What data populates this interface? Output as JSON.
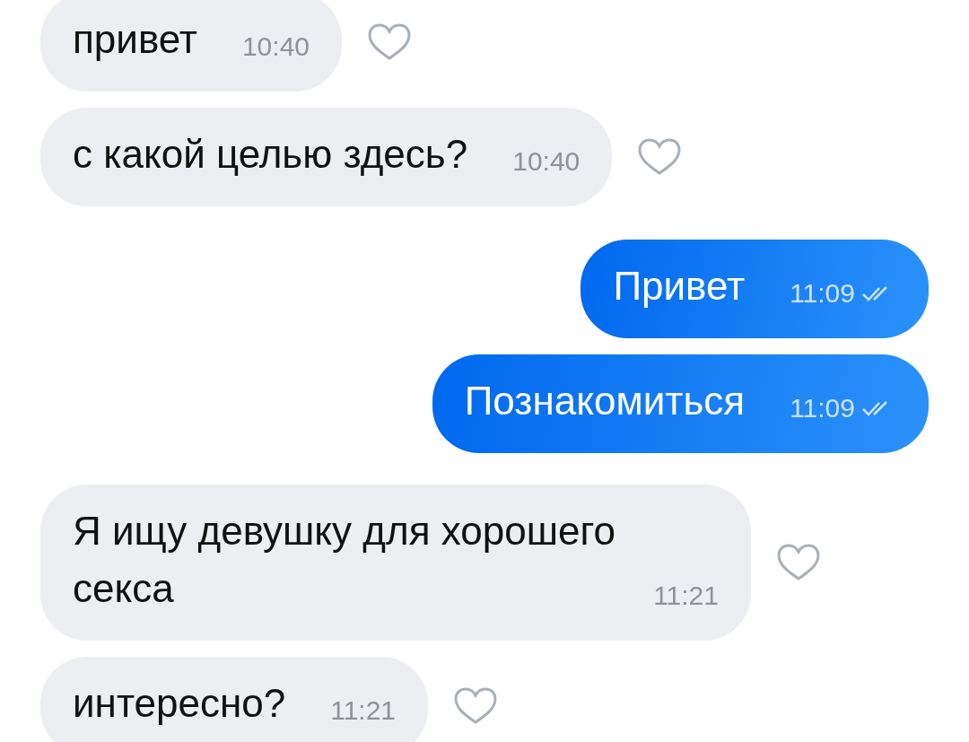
{
  "messages": [
    {
      "kind": "incoming",
      "text": "привет",
      "time": "10:40",
      "liked": false
    },
    {
      "kind": "incoming",
      "text": "с какой целью здесь?",
      "time": "10:40",
      "liked": false
    },
    {
      "kind": "outgoing",
      "text": "Привет",
      "time": "11:09",
      "read": true
    },
    {
      "kind": "outgoing",
      "text": "Познакомиться",
      "time": "11:09",
      "read": true
    },
    {
      "kind": "incoming",
      "text": "Я ищу девушку для хорошего секса",
      "time": "11:21",
      "liked": false
    },
    {
      "kind": "incoming",
      "text": "интересно?",
      "time": "11:21",
      "liked": false
    }
  ]
}
